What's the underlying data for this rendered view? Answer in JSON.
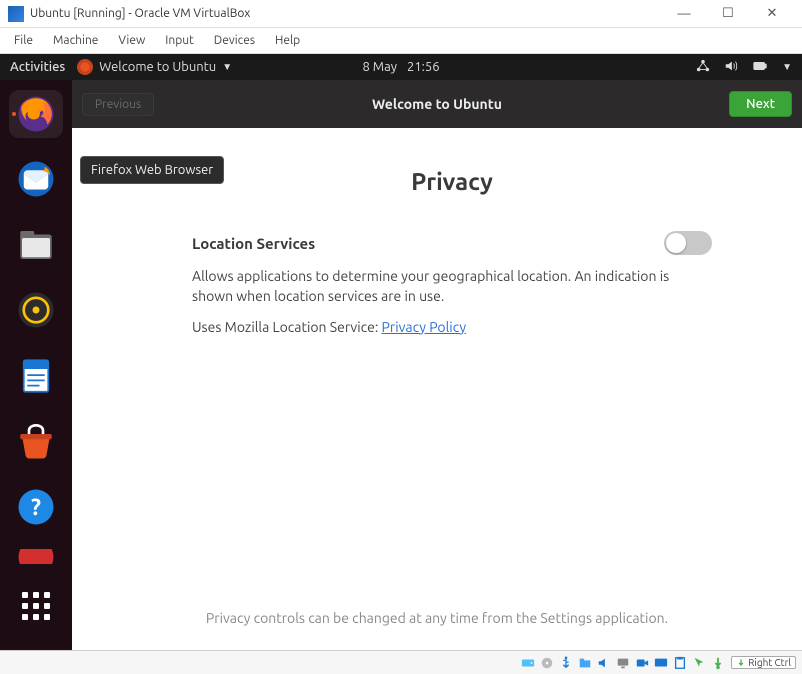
{
  "host_window": {
    "title": "Ubuntu [Running] - Oracle VM VirtualBox",
    "menu": [
      "File",
      "Machine",
      "View",
      "Input",
      "Devices",
      "Help"
    ],
    "buttons": {
      "minimize": "—",
      "maximize": "☐",
      "close": "✕"
    },
    "host_key": "Right Ctrl"
  },
  "top_panel": {
    "activities": "Activities",
    "app_name": "Welcome to Ubuntu",
    "date": "8 May",
    "time": "21:56"
  },
  "dock": {
    "items": [
      {
        "name": "firefox",
        "tooltip": "Firefox Web Browser",
        "active": true
      },
      {
        "name": "thunderbird"
      },
      {
        "name": "files"
      },
      {
        "name": "rhythmbox"
      },
      {
        "name": "libreoffice"
      },
      {
        "name": "software"
      },
      {
        "name": "help"
      }
    ]
  },
  "tooltip_text": "Firefox Web Browser",
  "dialog": {
    "header_title": "Welcome to Ubuntu",
    "prev": "Previous",
    "next": "Next",
    "page_title": "Privacy",
    "section_title": "Location Services",
    "section_body": "Allows applications to determine your geographical location. An indication is shown when location services are in use.",
    "uses_prefix": "Uses Mozilla Location Service: ",
    "privacy_link": "Privacy Policy",
    "footer": "Privacy controls can be changed at any time from the Settings application."
  }
}
